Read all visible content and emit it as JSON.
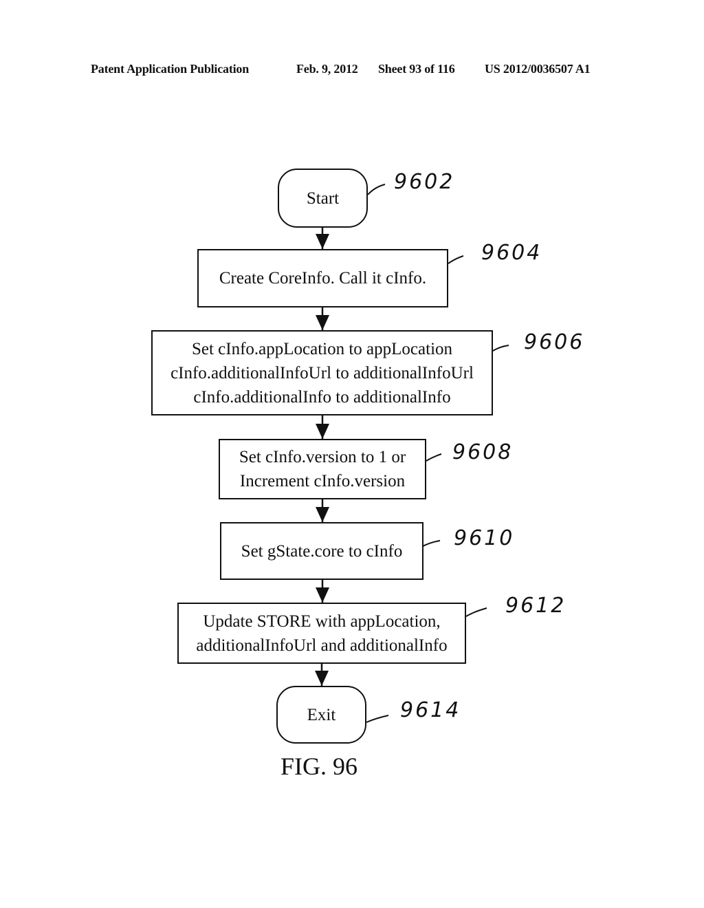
{
  "header": {
    "publication": "Patent Application Publication",
    "date": "Feb. 9, 2012",
    "sheet": "Sheet 93 of 116",
    "number": "US 2012/0036507 A1"
  },
  "flowchart": {
    "nodes": [
      {
        "id": "9602",
        "type": "terminal",
        "text": "Start"
      },
      {
        "id": "9604",
        "type": "process",
        "text": "Create CoreInfo. Call it cInfo."
      },
      {
        "id": "9606",
        "type": "process",
        "lines": [
          "Set cInfo.appLocation to appLocation",
          "cInfo.additionalInfoUrl to additionalInfoUrl",
          "cInfo.additionalInfo to additionalInfo"
        ]
      },
      {
        "id": "9608",
        "type": "process",
        "lines": [
          "Set cInfo.version to 1 or",
          "Increment cInfo.version"
        ]
      },
      {
        "id": "9610",
        "type": "process",
        "text": "Set gState.core to cInfo"
      },
      {
        "id": "9612",
        "type": "process",
        "lines": [
          "Update STORE with appLocation,",
          "additionalInfoUrl and additionalInfo"
        ]
      },
      {
        "id": "9614",
        "type": "terminal",
        "text": "Exit"
      }
    ],
    "edges": [
      [
        "9602",
        "9604"
      ],
      [
        "9604",
        "9606"
      ],
      [
        "9606",
        "9608"
      ],
      [
        "9608",
        "9610"
      ],
      [
        "9610",
        "9612"
      ],
      [
        "9612",
        "9614"
      ]
    ],
    "figure_label": "FIG. 96"
  }
}
